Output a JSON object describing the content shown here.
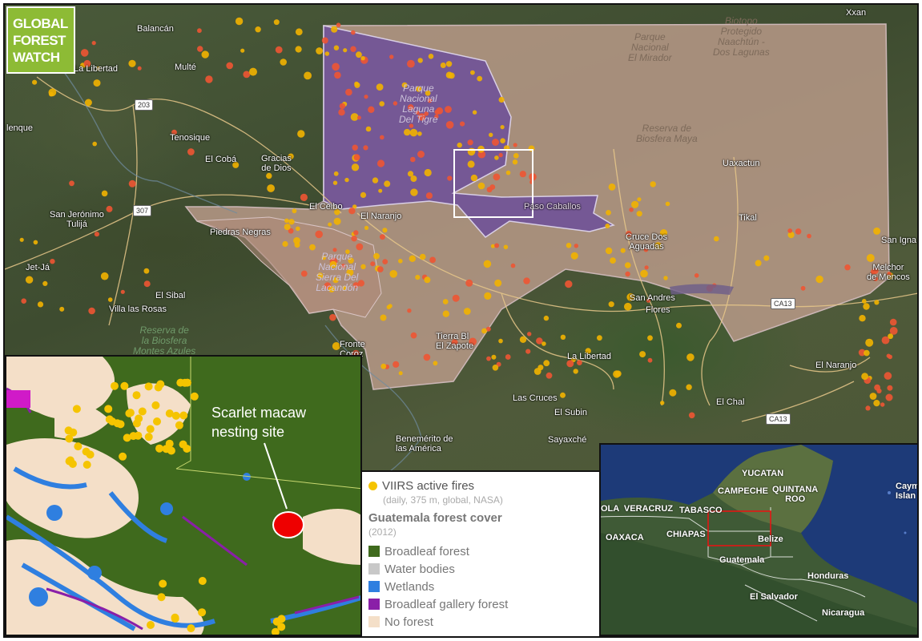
{
  "logo": {
    "line1": "GLOBAL",
    "line2": "FOREST",
    "line3": "WATCH"
  },
  "main_map": {
    "places": [
      {
        "id": "balancan",
        "name": "Balancán"
      },
      {
        "id": "multe",
        "name": "Multé"
      },
      {
        "id": "tenosique",
        "name": "Tenosique"
      },
      {
        "id": "elcoba",
        "name": "El Cobá"
      },
      {
        "id": "gracias",
        "name": "Gracias\nde Dios"
      },
      {
        "id": "lenque",
        "name": "lenque"
      },
      {
        "id": "sanjeronimo",
        "name": "San Jerónimo\nTulijá"
      },
      {
        "id": "jetja",
        "name": "Jet-Já"
      },
      {
        "id": "elsibal",
        "name": "El Sibal"
      },
      {
        "id": "villarosas",
        "name": "Villa las Rosas"
      },
      {
        "id": "elceibo",
        "name": "El Ceibo"
      },
      {
        "id": "elnaranjo",
        "name": "El Naranjo"
      },
      {
        "id": "piedrasnegras",
        "name": "Piedras Negras"
      },
      {
        "id": "uaxactun",
        "name": "Uaxactun"
      },
      {
        "id": "tikal",
        "name": "Tikal"
      },
      {
        "id": "crucedos",
        "name": "Cruce Dos\nAguadas"
      },
      {
        "id": "sanandres",
        "name": "San Andres"
      },
      {
        "id": "flores",
        "name": "Flores"
      },
      {
        "id": "laliberdad",
        "name": "La Libertad"
      },
      {
        "id": "lascruces",
        "name": "Las Cruces"
      },
      {
        "id": "elsubin",
        "name": "El Subin"
      },
      {
        "id": "sayaxche",
        "name": "Sayaxché"
      },
      {
        "id": "benemerito",
        "name": "Benemérito de\nlas América"
      },
      {
        "id": "elchal",
        "name": "El Chal"
      },
      {
        "id": "elnaranjo2",
        "name": "El Naranjo"
      },
      {
        "id": "sanigna",
        "name": "San Igna"
      },
      {
        "id": "melchor",
        "name": "Melchor\nde Mencos"
      },
      {
        "id": "xxan",
        "name": "Xxan"
      },
      {
        "id": "fronte",
        "name": "Fronte\nCoroz"
      },
      {
        "id": "libertad_mx",
        "name": "La Libertad"
      },
      {
        "id": "tierrasblancas",
        "name": "Tierra Bl\nEl Zapote"
      },
      {
        "id": "pasocaballos",
        "name": "Paso Caballos"
      }
    ],
    "parks": [
      {
        "id": "mirador",
        "name": "Parque\nNacional\nEl Mirador"
      },
      {
        "id": "naachtun",
        "name": "Biotopo\nProtegido\nNaachtún -\nDos Lagunas"
      },
      {
        "id": "maya",
        "name": "Reserva de\nBiosfera Maya"
      },
      {
        "id": "lagunatigre",
        "name": "Parque\nNacional\nLaguna\nDel Tigre"
      },
      {
        "id": "lacandon",
        "name": "Parque\nNacional\nSierra Del\nLacandón"
      },
      {
        "id": "montesazules",
        "name": "Reserva de\nla Biosfera\nMontes Azules"
      }
    ],
    "roads": [
      "203",
      "307",
      "CA13",
      "CA13"
    ]
  },
  "inset_left": {
    "annotation": "Scarlet macaw\nnesting site"
  },
  "legend": {
    "fires_title": "VIIRS active fires",
    "fires_sub": "(daily, 375 m, global, NASA)",
    "forest_title": "Guatemala forest cover",
    "forest_sub": "(2012)",
    "items": [
      {
        "label": "Broadleaf forest",
        "color": "#3f6a1d"
      },
      {
        "label": "Water bodies",
        "color": "#c8c8c8"
      },
      {
        "label": "Wetlands",
        "color": "#2f7fe0"
      },
      {
        "label": "Broadleaf gallery forest",
        "color": "#8a1fa8"
      },
      {
        "label": "No forest",
        "color": "#f4dfc8"
      }
    ],
    "fire_color": "#f5c400"
  },
  "inset_right": {
    "labels": [
      {
        "id": "yucatan",
        "name": "YUCATAN"
      },
      {
        "id": "campeche",
        "name": "CAMPECHE"
      },
      {
        "id": "quintana",
        "name": "QUINTANA\nROO"
      },
      {
        "id": "caym",
        "name": "Caym\nIslan"
      },
      {
        "id": "veracruz",
        "name": "OLA  VERACRUZ"
      },
      {
        "id": "tabasco",
        "name": "TABASCO"
      },
      {
        "id": "oaxaca",
        "name": "OAXACA"
      },
      {
        "id": "chiapas",
        "name": "CHIAPAS"
      },
      {
        "id": "belize",
        "name": "Belize"
      },
      {
        "id": "guatemala",
        "name": "Guatemala"
      },
      {
        "id": "honduras",
        "name": "Honduras"
      },
      {
        "id": "elsalvador",
        "name": "El Salvador"
      },
      {
        "id": "nicaragua",
        "name": "Nicaragua"
      }
    ]
  }
}
